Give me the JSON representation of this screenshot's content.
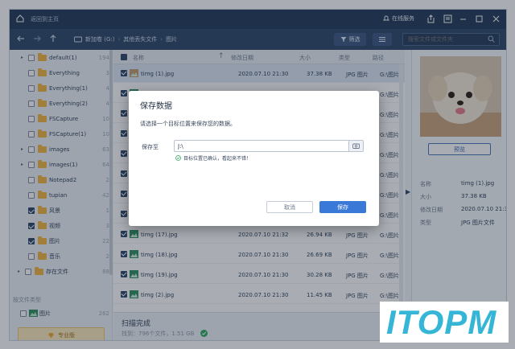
{
  "titlebar": {
    "back_home": "返回到主页",
    "service": "在线服务"
  },
  "breadcrumb": {
    "drive": "新加卷 (G:)",
    "folder": "其他丢失文件",
    "current": "图片"
  },
  "toolbar": {
    "filter_label": "筛选",
    "search_placeholder": "搜索文件或文件夹"
  },
  "sidebar": {
    "items": [
      {
        "label": "default(1)",
        "count": "194",
        "checked": false,
        "arrow": "▸"
      },
      {
        "label": "Everything",
        "count": "3",
        "checked": false,
        "arrow": ""
      },
      {
        "label": "Everything(1)",
        "count": "4",
        "checked": false,
        "arrow": ""
      },
      {
        "label": "Everything(2)",
        "count": "4",
        "checked": false,
        "arrow": ""
      },
      {
        "label": "FSCapture",
        "count": "10",
        "checked": false,
        "arrow": ""
      },
      {
        "label": "FSCapture(1)",
        "count": "10",
        "checked": false,
        "arrow": ""
      },
      {
        "label": "images",
        "count": "63",
        "checked": false,
        "arrow": "▸"
      },
      {
        "label": "images(1)",
        "count": "64",
        "checked": false,
        "arrow": "▸"
      },
      {
        "label": "Notepad2",
        "count": "2",
        "checked": false,
        "arrow": ""
      },
      {
        "label": "tupian",
        "count": "42",
        "checked": false,
        "arrow": ""
      },
      {
        "label": "风景",
        "count": "1",
        "checked": true,
        "arrow": ""
      },
      {
        "label": "视频",
        "count": "3",
        "checked": true,
        "arrow": ""
      },
      {
        "label": "图片",
        "count": "22",
        "checked": true,
        "arrow": ""
      },
      {
        "label": "音乐",
        "count": "2",
        "checked": false,
        "arrow": ""
      },
      {
        "label": "存在文件",
        "count": "88",
        "checked": false,
        "arrow": "▸"
      }
    ],
    "section_label": "按文件类型",
    "type_item": {
      "label": "图片",
      "count": "262"
    },
    "vip_label": "专业版"
  },
  "table": {
    "headers": {
      "name": "名称",
      "date": "修改日期",
      "size": "大小",
      "type": "类型",
      "path": "路径"
    },
    "rows": [
      {
        "name": "timg (1).jpg",
        "date": "2020.07.10 21:30",
        "size": "37.38 KB",
        "type": "JPG 图片",
        "path": "G:\\图片"
      },
      {
        "name": "t",
        "date": "",
        "size": "",
        "type": "",
        "path": "G:\\图片"
      },
      {
        "name": "t",
        "date": "",
        "size": "",
        "type": "",
        "path": "G:\\图片"
      },
      {
        "name": "t",
        "date": "",
        "size": "",
        "type": "",
        "path": "G:\\图片"
      },
      {
        "name": "t",
        "date": "",
        "size": "",
        "type": "",
        "path": "G:\\图片"
      },
      {
        "name": "t",
        "date": "",
        "size": "",
        "type": "",
        "path": "G:\\图片"
      },
      {
        "name": "t",
        "date": "",
        "size": "",
        "type": "",
        "path": "G:\\图片"
      },
      {
        "name": "t",
        "date": "",
        "size": "",
        "type": "",
        "path": "G:\\图片"
      },
      {
        "name": "timg (17).jpg",
        "date": "2020.07.10 21:32",
        "size": "26.94 KB",
        "type": "JPG 图片",
        "path": "G:\\图片"
      },
      {
        "name": "timg (18).jpg",
        "date": "2020.07.10 21:30",
        "size": "26.69 KB",
        "type": "JPG 图片",
        "path": "G:\\图片"
      },
      {
        "name": "timg (19).jpg",
        "date": "2020.07.10 21:30",
        "size": "30.28 KB",
        "type": "JPG 图片",
        "path": "G:\\图片"
      },
      {
        "name": "timg (2).jpg",
        "date": "2020.07.10 21:30",
        "size": "11.45 KB",
        "type": "JPG 图片",
        "path": "G:\\图片"
      }
    ]
  },
  "status": {
    "title": "扫描完成",
    "summary": "找到：796个文件，1.51 GB"
  },
  "preview": {
    "button": "预览",
    "props": [
      {
        "key": "名称",
        "value": "timg (1).jpg"
      },
      {
        "key": "大小",
        "value": "37.38 KB"
      },
      {
        "key": "修改日期",
        "value": "2020.07.10 21:30"
      },
      {
        "key": "类型",
        "value": "JPG 图片文件"
      }
    ]
  },
  "dialog": {
    "title": "保存数据",
    "description": "请选择一个目标位置来保存您的数据。",
    "path_label": "保存至",
    "path_value": "J:\\",
    "valid_message": "目标位置已确认，看起来不错！",
    "cancel_label": "取消",
    "save_label": "保存"
  },
  "watermark": {
    "text": "ITOPM"
  },
  "colors": {
    "titlebar": "#213756",
    "navbar": "#2b4468",
    "accent": "#3b79d8",
    "watermark": "#35b6d6"
  }
}
